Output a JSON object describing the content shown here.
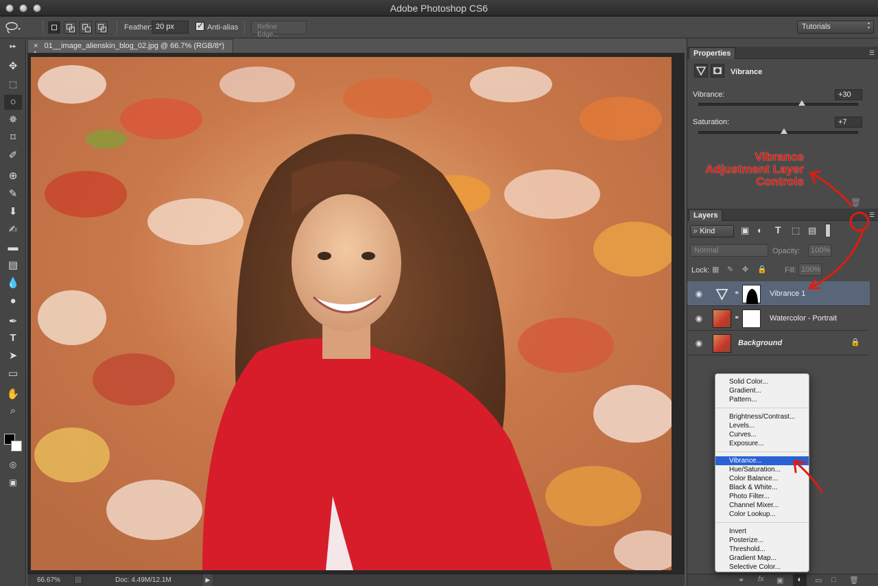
{
  "app": {
    "title": "Adobe Photoshop CS6"
  },
  "options_bar": {
    "feather_label": "Feather:",
    "feather_value": "20 px",
    "antialias_label": "Anti-alias",
    "refine_edge_label": "Refine Edge...",
    "workspace": "Tutorials"
  },
  "document": {
    "tab_title": "01__image_alienskin_blog_02.jpg @ 66.7% (RGB/8*) *",
    "zoom": "66.67%",
    "doc_size": "Doc: 4.49M/12.1M"
  },
  "properties": {
    "tab": "Properties",
    "adjustment_name": "Vibrance",
    "vibrance_label": "Vibrance:",
    "vibrance_value": "+30",
    "vibrance_level": 0.65,
    "saturation_label": "Saturation:",
    "saturation_value": "+7",
    "saturation_level": 0.535
  },
  "annotation": {
    "line1": "Vibrance",
    "line2": "Adjustment Layer",
    "line3": "Controls"
  },
  "layers": {
    "tab": "Layers",
    "filter_kind": "Kind",
    "blend_mode": "Normal",
    "opacity_label": "Opacity:",
    "opacity_value": "100%",
    "lock_label": "Lock:",
    "fill_label": "Fill:",
    "fill_value": "100%",
    "items": [
      {
        "name": "Vibrance 1"
      },
      {
        "name": "Watercolor - Portrait"
      },
      {
        "name": "Background"
      }
    ]
  },
  "adjustment_menu": {
    "groups": [
      [
        "Solid Color...",
        "Gradient...",
        "Pattern..."
      ],
      [
        "Brightness/Contrast...",
        "Levels...",
        "Curves...",
        "Exposure..."
      ],
      [
        "Vibrance...",
        "Hue/Saturation...",
        "Color Balance...",
        "Black & White...",
        "Photo Filter...",
        "Channel Mixer...",
        "Color Lookup..."
      ],
      [
        "Invert",
        "Posterize...",
        "Threshold...",
        "Gradient Map...",
        "Selective Color..."
      ]
    ],
    "highlighted": "Vibrance..."
  },
  "colors": {
    "accent": "#2a61d4",
    "annotation": "#e01b0f",
    "selected_layer": "#59667a"
  }
}
